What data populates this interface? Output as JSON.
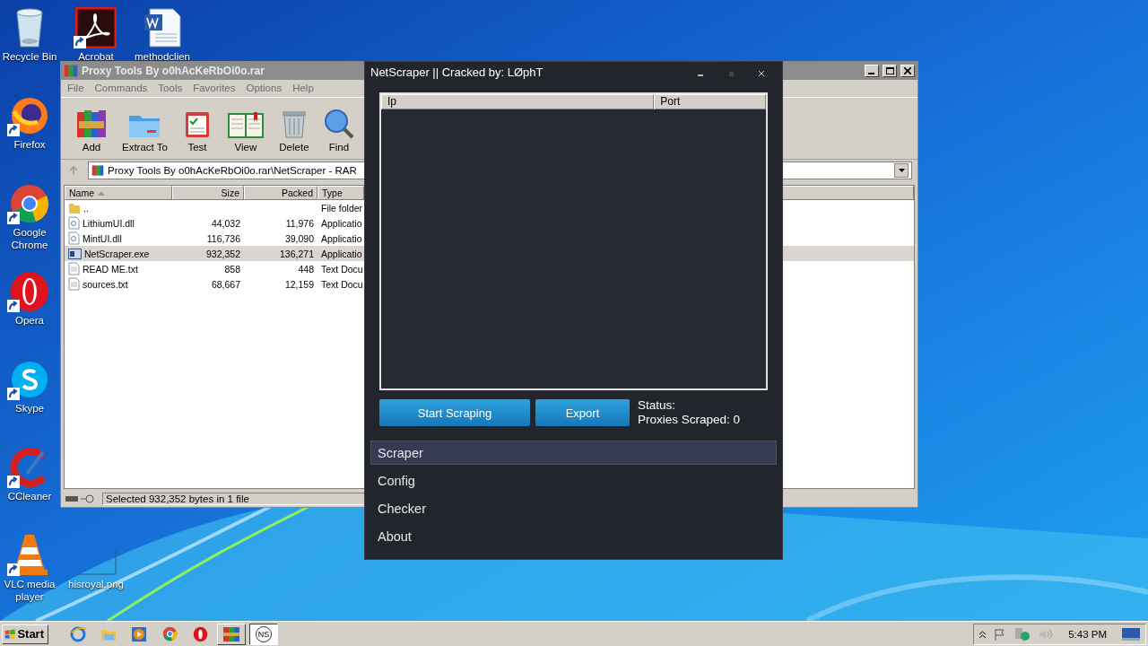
{
  "desktop_icons": [
    {
      "label": "Recycle Bin",
      "kind": "recycle",
      "shortcut": false
    },
    {
      "label": "Acrobat",
      "kind": "acrobat",
      "shortcut": true
    },
    {
      "label": "methodclien",
      "kind": "word",
      "shortcut": false
    },
    {
      "label": "Firefox",
      "kind": "firefox",
      "shortcut": true
    },
    {
      "label": "Google Chrome",
      "kind": "chrome",
      "shortcut": true
    },
    {
      "label": "Opera",
      "kind": "opera",
      "shortcut": true
    },
    {
      "label": "Skype",
      "kind": "skype",
      "shortcut": true
    },
    {
      "label": "CCleaner",
      "kind": "ccleaner",
      "shortcut": true
    },
    {
      "label": "VLC media player",
      "kind": "vlc",
      "shortcut": true
    },
    {
      "label": "hisroyal.png",
      "kind": "image",
      "shortcut": false
    }
  ],
  "winrar": {
    "title": "Proxy Tools By o0hAcKeRbOi0o.rar",
    "menu": [
      "File",
      "Commands",
      "Tools",
      "Favorites",
      "Options",
      "Help"
    ],
    "toolbar": [
      {
        "label": "Add",
        "kind": "add"
      },
      {
        "label": "Extract To",
        "kind": "extract"
      },
      {
        "label": "Test",
        "kind": "test"
      },
      {
        "label": "View",
        "kind": "view"
      },
      {
        "label": "Delete",
        "kind": "delete"
      },
      {
        "label": "Find",
        "kind": "find"
      }
    ],
    "address": "Proxy Tools By o0hAcKeRbOi0o.rar\\NetScraper - RAR",
    "columns": [
      "Name",
      "Size",
      "Packed",
      "Type"
    ],
    "rows": [
      {
        "name": "..",
        "kind": "folder",
        "type": "File folder",
        "selected": false
      },
      {
        "name": "LithiumUI.dll",
        "kind": "dll",
        "size": "44,032",
        "packed": "11,976",
        "type": "Applicatio",
        "selected": false
      },
      {
        "name": "MintUI.dll",
        "kind": "dll",
        "size": "116,736",
        "packed": "39,090",
        "type": "Applicatio",
        "selected": false
      },
      {
        "name": "NetScraper.exe",
        "kind": "exe",
        "size": "932,352",
        "packed": "136,271",
        "type": "Applicatio",
        "selected": true
      },
      {
        "name": "READ ME.txt",
        "kind": "txt",
        "size": "858",
        "packed": "448",
        "type": "Text Docu",
        "selected": false
      },
      {
        "name": "sources.txt",
        "kind": "txt",
        "size": "68,667",
        "packed": "12,159",
        "type": "Text Docu",
        "selected": false
      }
    ],
    "status": "Selected 932,352 bytes in 1 file"
  },
  "netscraper": {
    "title": "NetScraper || Cracked by: LØphT",
    "columns": [
      "Ip",
      "Port"
    ],
    "buttons": [
      "Start Scraping",
      "Export"
    ],
    "status_label": "Status:",
    "proxies_scraped": "Proxies Scraped: 0",
    "nav": [
      {
        "label": "Scraper",
        "selected": true
      },
      {
        "label": "Config",
        "selected": false
      },
      {
        "label": "Checker",
        "selected": false
      },
      {
        "label": "About",
        "selected": false
      }
    ]
  },
  "taskbar": {
    "start": "Start",
    "apps": [
      {
        "kind": "ie",
        "running": false,
        "selected": false
      },
      {
        "kind": "explorer",
        "running": false,
        "selected": false
      },
      {
        "kind": "media",
        "running": false,
        "selected": false
      },
      {
        "kind": "chrome",
        "running": false,
        "selected": false
      },
      {
        "kind": "opera",
        "running": false,
        "selected": false
      },
      {
        "kind": "winrar",
        "running": true,
        "selected": false
      },
      {
        "kind": "ns",
        "label": "NS",
        "running": true,
        "selected": true
      }
    ],
    "clock": "5:43 PM"
  }
}
